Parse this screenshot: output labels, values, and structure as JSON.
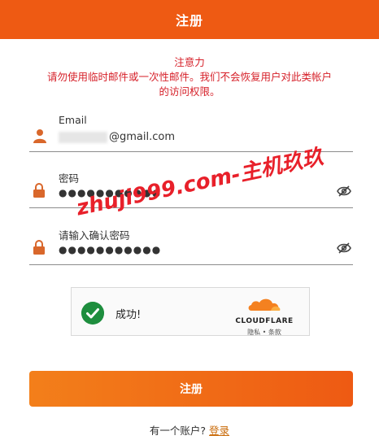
{
  "header": {
    "title": "注册"
  },
  "notice": {
    "title": "注意力",
    "line1": "请勿使用临时邮件或一次性邮件。我们不会恢复用户对此类帐户",
    "line2": "的访问权限。"
  },
  "form": {
    "email": {
      "label": "Email",
      "value_suffix": "@gmail.com"
    },
    "password": {
      "label": "密码",
      "value": "●●●●●●●●●●●"
    },
    "confirm": {
      "label": "请输入确认密码",
      "value": "●●●●●●●●●●●"
    }
  },
  "watermark": {
    "text": "zhuji999.com-主机玖玖"
  },
  "captcha": {
    "status": "成功!",
    "brand": "CLOUDFLARE",
    "privacy": "隐私",
    "separator": "•",
    "terms": "条款"
  },
  "submit": {
    "label": "注册"
  },
  "footer": {
    "prompt": "有一个账户?",
    "login": "登录"
  },
  "colors": {
    "accent": "#ee5a13",
    "notice": "#d6212a",
    "success": "#1e8e3e",
    "link": "#c96a08"
  }
}
